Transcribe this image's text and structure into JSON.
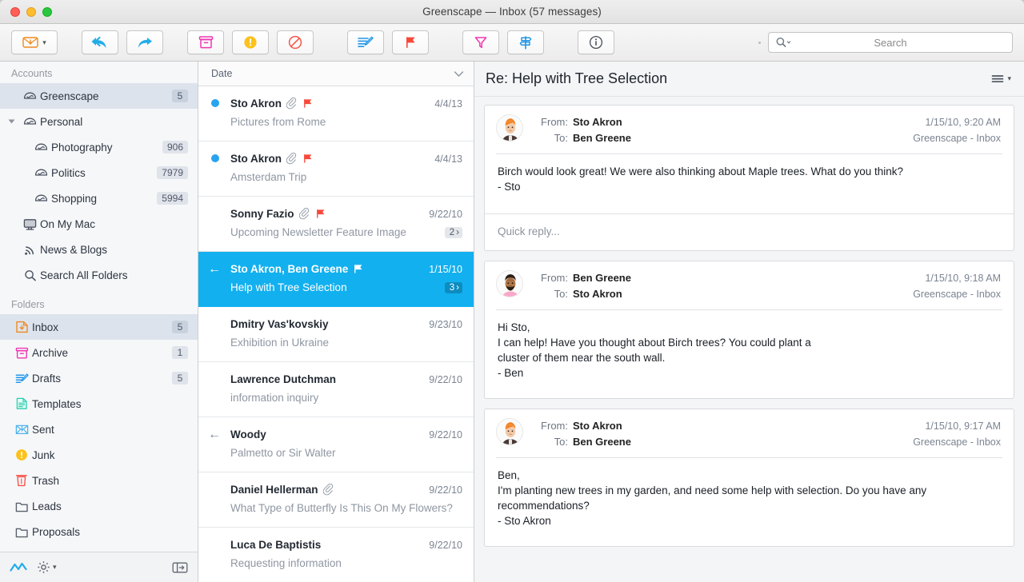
{
  "window": {
    "title": "Greenscape — Inbox (57 messages)",
    "accent_blue": "#12b0ef",
    "traffic_lights": [
      "close",
      "minimize",
      "zoom"
    ]
  },
  "toolbar": {
    "buttons": [
      {
        "name": "get-mail-button",
        "icon": "envelope-down-icon",
        "label": "",
        "has_chevron": true
      },
      {
        "name": "reply-all-button",
        "icon": "reply-all-icon",
        "label": ""
      },
      {
        "name": "forward-button",
        "icon": "forward-arrow-icon",
        "label": ""
      },
      {
        "name": "archive-button",
        "icon": "archive-box-icon",
        "label": ""
      },
      {
        "name": "junk-button",
        "icon": "exclamation-circle-icon",
        "label": ""
      },
      {
        "name": "block-button",
        "icon": "no-entry-icon",
        "label": ""
      },
      {
        "name": "compose-button",
        "icon": "compose-pencil-icon",
        "label": ""
      },
      {
        "name": "flag-button",
        "icon": "red-flag-icon",
        "label": ""
      },
      {
        "name": "filter-button",
        "icon": "funnel-icon",
        "label": ""
      },
      {
        "name": "thread-button",
        "icon": "signpost-icon",
        "label": ""
      },
      {
        "name": "info-button",
        "icon": "info-circle-icon",
        "label": ""
      }
    ],
    "search": {
      "placeholder": "Search",
      "value": "",
      "icon": "search-magnifier-icon"
    }
  },
  "sidebar": {
    "accounts_header": "Accounts",
    "accounts": [
      {
        "label": "Greenscape",
        "badge": "5",
        "icon": "mailbox-icon",
        "selected": true,
        "indent": 1,
        "disclosure": false
      },
      {
        "label": "Personal",
        "badge": "",
        "icon": "mailbox-icon",
        "selected": false,
        "indent": 1,
        "disclosure": true
      },
      {
        "label": "Photography",
        "badge": "906",
        "icon": "mailbox-icon",
        "selected": false,
        "indent": 2,
        "disclosure": false
      },
      {
        "label": "Politics",
        "badge": "7979",
        "icon": "mailbox-icon",
        "selected": false,
        "indent": 2,
        "disclosure": false
      },
      {
        "label": "Shopping",
        "badge": "5994",
        "icon": "mailbox-icon",
        "selected": false,
        "indent": 2,
        "disclosure": false
      },
      {
        "label": "On My Mac",
        "badge": "",
        "icon": "computer-icon",
        "selected": false,
        "indent": 1,
        "disclosure": false
      },
      {
        "label": "News & Blogs",
        "badge": "",
        "icon": "rss-icon",
        "selected": false,
        "indent": 1,
        "disclosure": false
      },
      {
        "label": "Search All Folders",
        "badge": "",
        "icon": "search-magnifier-icon",
        "selected": false,
        "indent": 1,
        "disclosure": false
      }
    ],
    "folders_header": "Folders",
    "folders": [
      {
        "label": "Inbox",
        "badge": "5",
        "icon": "inbox-tray-icon",
        "selected": true
      },
      {
        "label": "Archive",
        "badge": "1",
        "icon": "archive-box-icon",
        "selected": false
      },
      {
        "label": "Drafts",
        "badge": "5",
        "icon": "compose-pencil-icon",
        "selected": false
      },
      {
        "label": "Templates",
        "badge": "",
        "icon": "document-lines-icon",
        "selected": false
      },
      {
        "label": "Sent",
        "badge": "",
        "icon": "sent-envelope-icon",
        "selected": false
      },
      {
        "label": "Junk",
        "badge": "",
        "icon": "exclamation-circle-icon",
        "selected": false
      },
      {
        "label": "Trash",
        "badge": "",
        "icon": "trash-can-icon",
        "selected": false
      },
      {
        "label": "Leads",
        "badge": "",
        "icon": "folder-icon",
        "selected": false
      },
      {
        "label": "Proposals",
        "badge": "",
        "icon": "folder-icon",
        "selected": false
      }
    ],
    "footer": {
      "activity_icon": "activity-zigzag-icon",
      "settings_icon": "gear-icon",
      "settings_has_chevron": true,
      "panel_toggle_icon": "panel-toggle-icon"
    }
  },
  "message_list": {
    "sort_label": "Date",
    "sort_chevron_icon": "chevron-down-icon",
    "rows": [
      {
        "sender": "Sto Akron",
        "subject": "Pictures from Rome",
        "date": "4/4/13",
        "unread": true,
        "replied": false,
        "attachment": true,
        "flagged": true,
        "thread_count": "",
        "selected": false
      },
      {
        "sender": "Sto Akron",
        "subject": "Amsterdam Trip",
        "date": "4/4/13",
        "unread": true,
        "replied": false,
        "attachment": true,
        "flagged": true,
        "thread_count": "",
        "selected": false
      },
      {
        "sender": "Sonny Fazio",
        "subject": "Upcoming Newsletter Feature Image",
        "date": "9/22/10",
        "unread": false,
        "replied": false,
        "attachment": true,
        "flagged": true,
        "thread_count": "2",
        "selected": false
      },
      {
        "sender": "Sto Akron, Ben Greene",
        "subject": "Help with Tree Selection",
        "date": "1/15/10",
        "unread": false,
        "replied": true,
        "attachment": false,
        "flagged": true,
        "thread_count": "3",
        "selected": true
      },
      {
        "sender": "Dmitry Vas'kovskiy",
        "subject": "Exhibition in Ukraine",
        "date": "9/23/10",
        "unread": false,
        "replied": false,
        "attachment": false,
        "flagged": false,
        "thread_count": "",
        "selected": false
      },
      {
        "sender": "Lawrence Dutchman",
        "subject": "information inquiry",
        "date": "9/22/10",
        "unread": false,
        "replied": false,
        "attachment": false,
        "flagged": false,
        "thread_count": "",
        "selected": false
      },
      {
        "sender": "Woody",
        "subject": "Palmetto or Sir Walter",
        "date": "9/22/10",
        "unread": false,
        "replied": true,
        "attachment": false,
        "flagged": false,
        "thread_count": "",
        "selected": false
      },
      {
        "sender": "Daniel Hellerman",
        "subject": "What Type of Butterfly Is This On My Flowers?",
        "date": "9/22/10",
        "unread": false,
        "replied": false,
        "attachment": true,
        "flagged": false,
        "thread_count": "",
        "selected": false
      },
      {
        "sender": "Luca De Baptistis",
        "subject": "Requesting information",
        "date": "9/22/10",
        "unread": false,
        "replied": false,
        "attachment": false,
        "flagged": false,
        "thread_count": "",
        "selected": false
      }
    ]
  },
  "reader": {
    "title": "Re: Help with Tree Selection",
    "options_icon": "list-options-icon",
    "from_label": "From:",
    "to_label": "To:",
    "messages": [
      {
        "avatar": "sto-akron-avatar",
        "from": "Sto Akron",
        "to": "Ben Greene",
        "timestamp": "1/15/10, 9:20 AM",
        "mailbox": "Greenscape - Inbox",
        "body": "Birch would look great!  We were also thinking about Maple trees.  What do you think?\n- Sto",
        "quick_reply_placeholder": "Quick reply..."
      },
      {
        "avatar": "ben-greene-avatar",
        "from": "Ben Greene",
        "to": "Sto Akron",
        "timestamp": "1/15/10, 9:18 AM",
        "mailbox": "Greenscape - Inbox",
        "body": "Hi Sto,\nI can help!  Have you thought about Birch trees?  You could plant a\ncluster of them near the south wall.\n- Ben",
        "quick_reply_placeholder": ""
      },
      {
        "avatar": "sto-akron-avatar",
        "from": "Sto Akron",
        "to": "Ben Greene",
        "timestamp": "1/15/10, 9:17 AM",
        "mailbox": "Greenscape - Inbox",
        "body": "Ben,\nI'm planting new trees in my garden, and need some help with selection.  Do you have any\nrecommendations?\n- Sto Akron",
        "quick_reply_placeholder": ""
      }
    ]
  }
}
